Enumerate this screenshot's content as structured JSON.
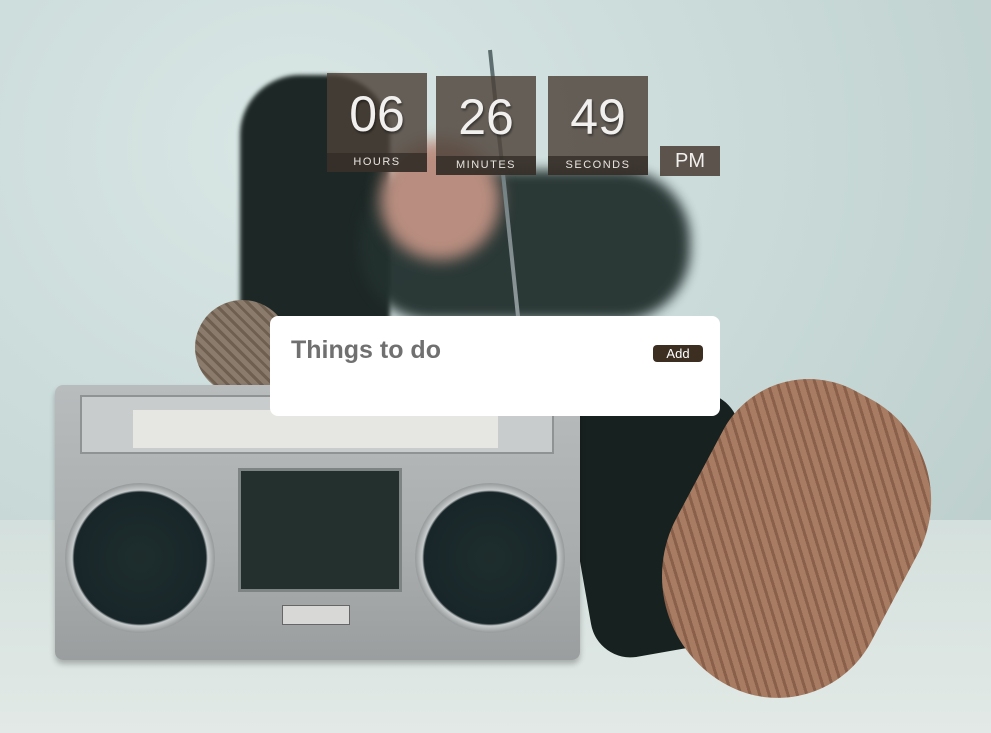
{
  "clock": {
    "hours": "06",
    "hours_label": "HOURS",
    "minutes": "26",
    "minutes_label": "MINUTES",
    "seconds": "49",
    "seconds_label": "SECONDS",
    "period": "PM"
  },
  "todo": {
    "title": "Things to do",
    "add_label": "Add"
  },
  "colors": {
    "tile": "#4c4138",
    "button": "#3d2e22",
    "card": "#ffffff"
  }
}
